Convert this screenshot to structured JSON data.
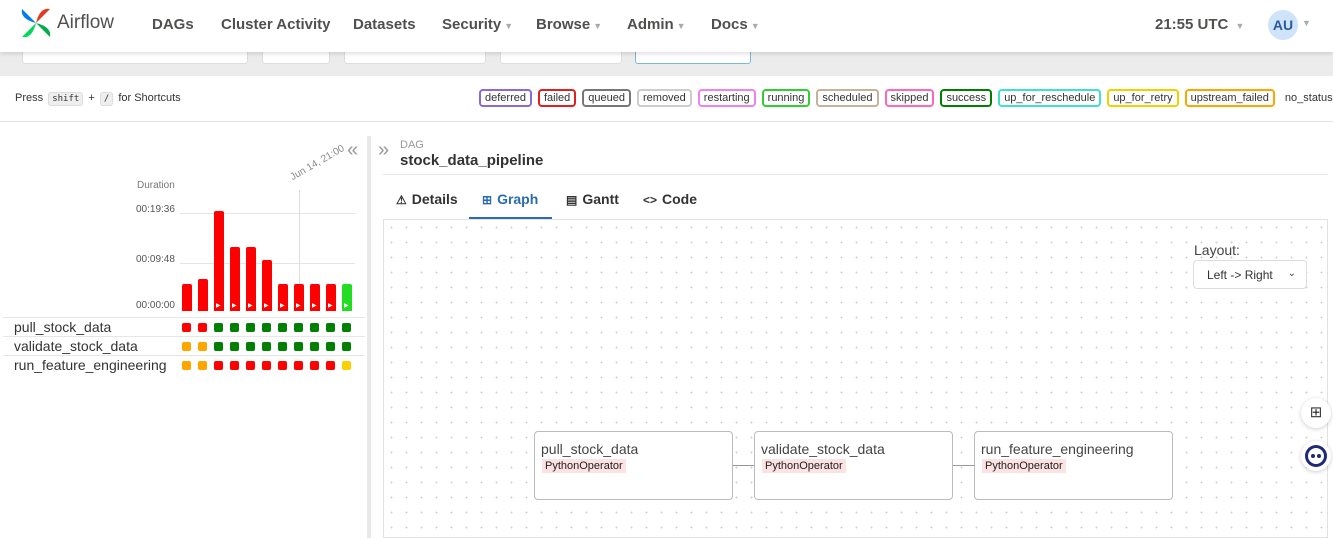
{
  "brand": "Airflow",
  "nav": {
    "items": [
      {
        "label": "DAGs",
        "caret": false
      },
      {
        "label": "Cluster Activity",
        "caret": false
      },
      {
        "label": "Datasets",
        "caret": false
      },
      {
        "label": "Security",
        "caret": true
      },
      {
        "label": "Browse",
        "caret": true
      },
      {
        "label": "Admin",
        "caret": true
      },
      {
        "label": "Docs",
        "caret": true
      }
    ],
    "clock": "21:55 UTC",
    "avatar": "AU"
  },
  "shortcut": {
    "prefix": "Press",
    "key1": "shift",
    "plus": "+",
    "key2": "/",
    "suffix": "for Shortcuts"
  },
  "states": [
    {
      "label": "deferred",
      "color": "#8a6ad6"
    },
    {
      "label": "failed",
      "color": "#e02020"
    },
    {
      "label": "queued",
      "color": "#777777"
    },
    {
      "label": "removed",
      "color": "#cccccc"
    },
    {
      "label": "restarting",
      "color": "#ee82ee"
    },
    {
      "label": "running",
      "color": "#32cd32"
    },
    {
      "label": "scheduled",
      "color": "#c4b39a"
    },
    {
      "label": "skipped",
      "color": "#ff69b4"
    },
    {
      "label": "success",
      "color": "#008000"
    },
    {
      "label": "up_for_reschedule",
      "color": "#40e0d0"
    },
    {
      "label": "up_for_retry",
      "color": "#f0d000"
    },
    {
      "label": "upstream_failed",
      "color": "#ffa500"
    }
  ],
  "state_no_status": "no_status",
  "grid": {
    "duration_label": "Duration",
    "ticks": [
      "00:19:36",
      "00:09:48",
      "00:00:00"
    ],
    "date_label": "Jun 14, 21:00",
    "run_durations": [
      0.27,
      0.32,
      1.0,
      0.64,
      0.64,
      0.51,
      0.27,
      0.27,
      0.27,
      0.27,
      0.27
    ],
    "run_states": [
      "failed",
      "failed",
      "failed",
      "failed",
      "failed",
      "failed",
      "failed",
      "failed",
      "failed",
      "failed",
      "success"
    ],
    "tasks": [
      {
        "name": "pull_stock_data",
        "states": [
          "failed",
          "failed",
          "success",
          "success",
          "success",
          "success",
          "success",
          "success",
          "success",
          "success",
          "success"
        ]
      },
      {
        "name": "validate_stock_data",
        "states": [
          "upstream_failed",
          "upstream_failed",
          "success",
          "success",
          "success",
          "success",
          "success",
          "success",
          "success",
          "success",
          "success"
        ]
      },
      {
        "name": "run_feature_engineering",
        "states": [
          "upstream_failed",
          "upstream_failed",
          "failed",
          "failed",
          "failed",
          "failed",
          "failed",
          "failed",
          "failed",
          "failed",
          "up_for_retry"
        ]
      }
    ]
  },
  "dag": {
    "kicker": "DAG",
    "name": "stock_data_pipeline"
  },
  "tabs": [
    {
      "label": "Details",
      "icon": "⚠"
    },
    {
      "label": "Graph",
      "icon": "⊞"
    },
    {
      "label": "Gantt",
      "icon": "▤"
    },
    {
      "label": "Code",
      "icon": "<>"
    }
  ],
  "graph": {
    "layout_label": "Layout:",
    "layout_value": "Left -> Right",
    "nodes": [
      {
        "name": "pull_stock_data",
        "operator": "PythonOperator"
      },
      {
        "name": "validate_stock_data",
        "operator": "PythonOperator"
      },
      {
        "name": "run_feature_engineering",
        "operator": "PythonOperator"
      }
    ]
  },
  "colors": {
    "failed": "#ff0000",
    "success": "#008000",
    "upstream_failed": "#ffa500",
    "up_for_retry": "#ffd000",
    "success_bar": "#22dd22"
  }
}
